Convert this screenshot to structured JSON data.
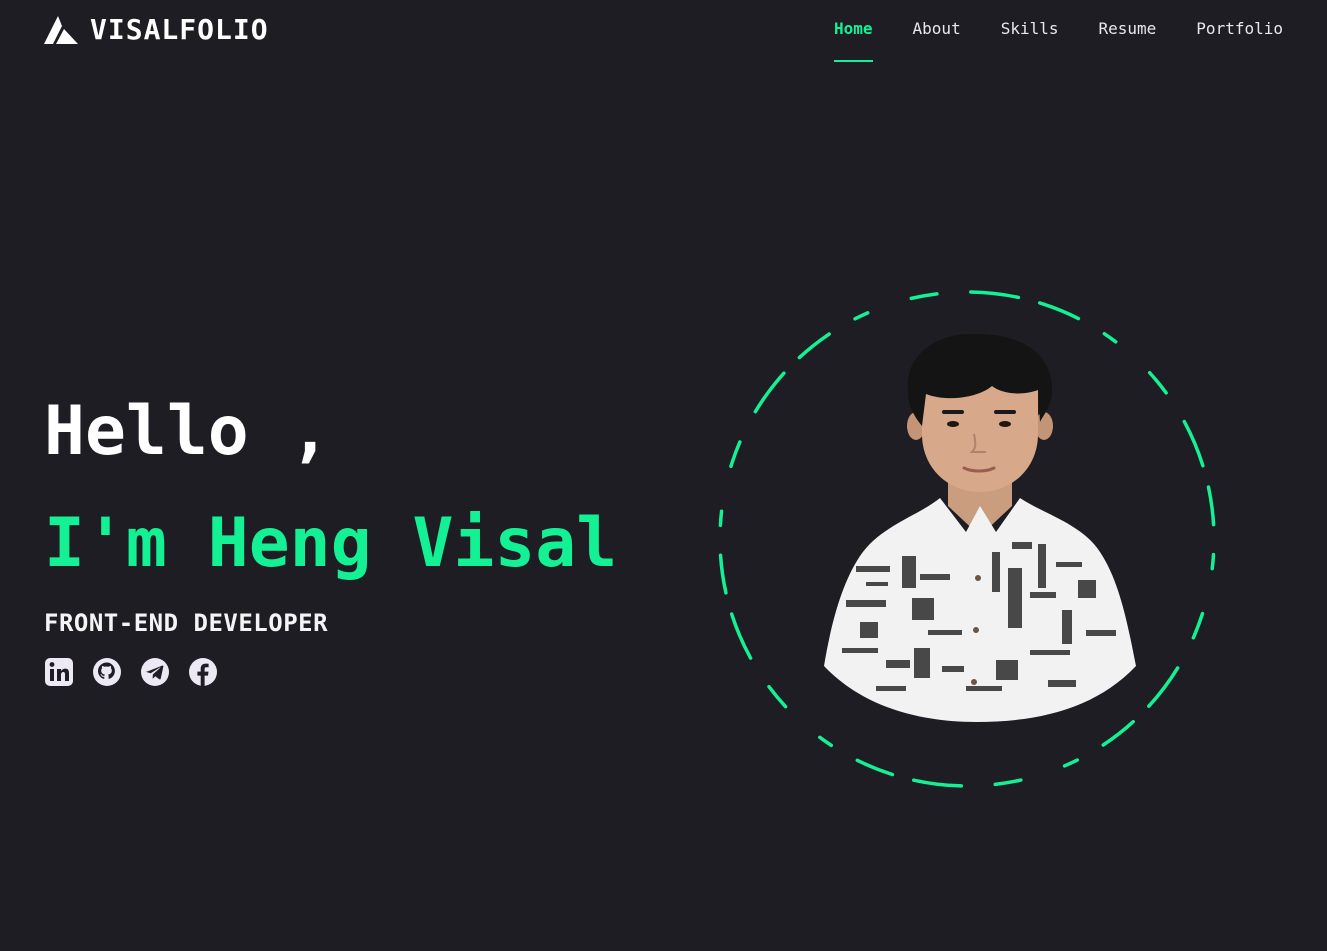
{
  "brand": {
    "name": "VISALFOLIO",
    "logo_icon": "triangle-logo-icon"
  },
  "nav": {
    "items": [
      {
        "label": "Home",
        "active": true
      },
      {
        "label": "About",
        "active": false
      },
      {
        "label": "Skills",
        "active": false
      },
      {
        "label": "Resume",
        "active": false
      },
      {
        "label": "Portfolio",
        "active": false
      }
    ]
  },
  "hero": {
    "greeting": "Hello ,",
    "name": "I'm Heng Visal",
    "role": "FRONT-END DEVELOPER"
  },
  "socials": [
    {
      "icon": "linkedin-icon"
    },
    {
      "icon": "github-icon"
    },
    {
      "icon": "telegram-icon"
    },
    {
      "icon": "facebook-icon"
    }
  ],
  "colors": {
    "background": "#1d1d23",
    "accent": "#14f195",
    "text": "#ffffff",
    "icon": "#ece8f4"
  }
}
